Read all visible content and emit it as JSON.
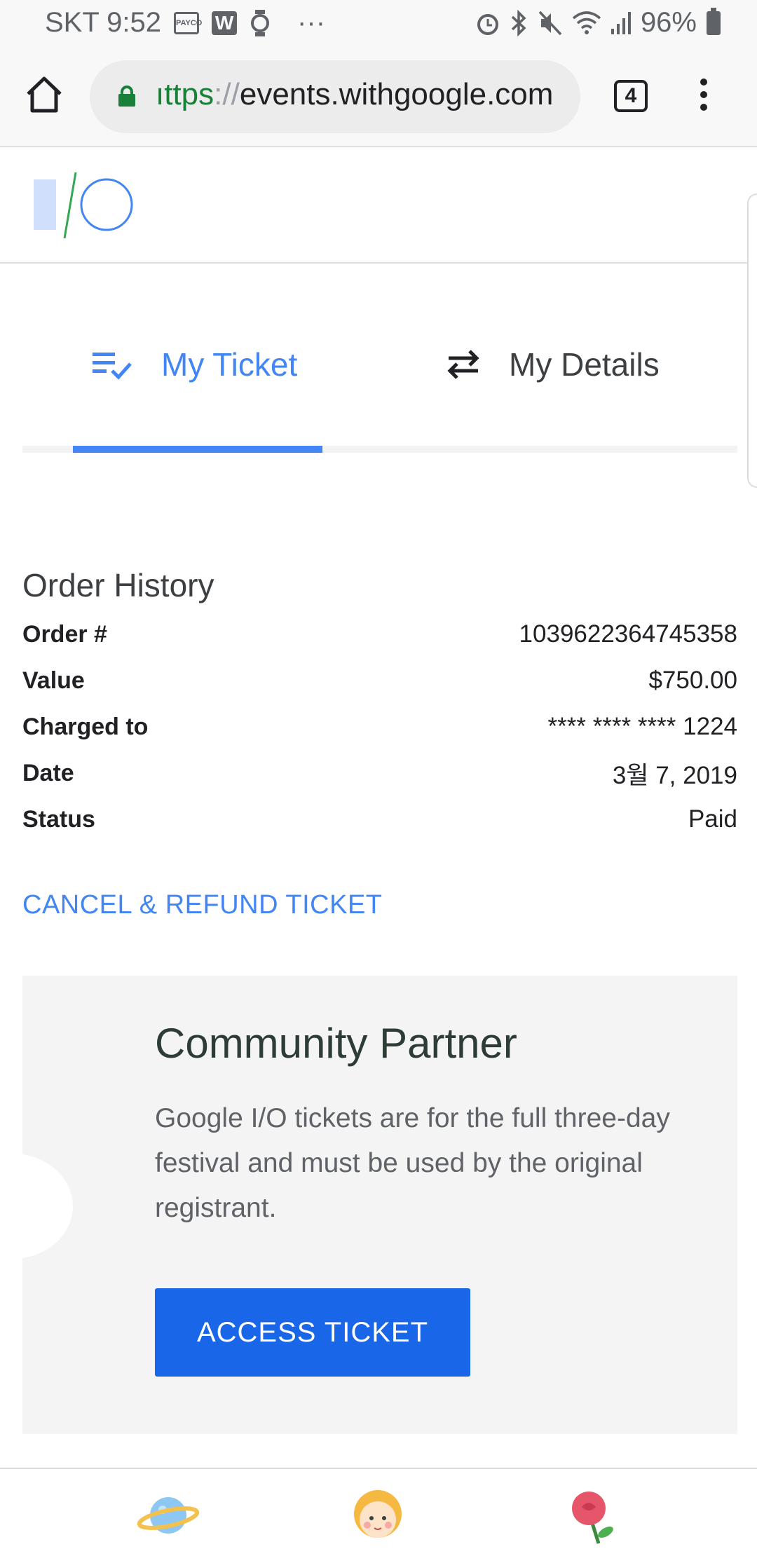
{
  "status_bar": {
    "carrier_time": "SKT 9:52",
    "pay_icon_text": "PAYCO",
    "w_icon_text": "W",
    "dots": "···",
    "battery": "96%"
  },
  "browser": {
    "url_scheme": "ıttps",
    "url_sep": "://",
    "url_host": "events.withgoogle.com",
    "tab_count": "4"
  },
  "tabs": [
    {
      "label": "My Ticket",
      "selected": true
    },
    {
      "label": "My Details",
      "selected": false
    }
  ],
  "order": {
    "title": "Order History",
    "rows": [
      {
        "label": "Order #",
        "value": "1039622364745358"
      },
      {
        "label": "Value",
        "value": "$750.00"
      },
      {
        "label": "Charged to",
        "value": "**** **** **** 1224"
      },
      {
        "label": "Date",
        "value": "3월 7, 2019"
      },
      {
        "label": "Status",
        "value": "Paid"
      }
    ]
  },
  "cancel_link": "CANCEL & REFUND TICKET",
  "card": {
    "title": "Community Partner",
    "body": "Google I/O tickets are for the full three-day festival and must be used by the original registrant.",
    "button": "ACCESS TICKET"
  },
  "colors": {
    "accent": "#4285f4",
    "button": "#1a66e8",
    "card_bg": "#f4f4f4"
  },
  "bottom_nav": [
    "planet-icon",
    "child-face-icon",
    "rose-icon"
  ]
}
